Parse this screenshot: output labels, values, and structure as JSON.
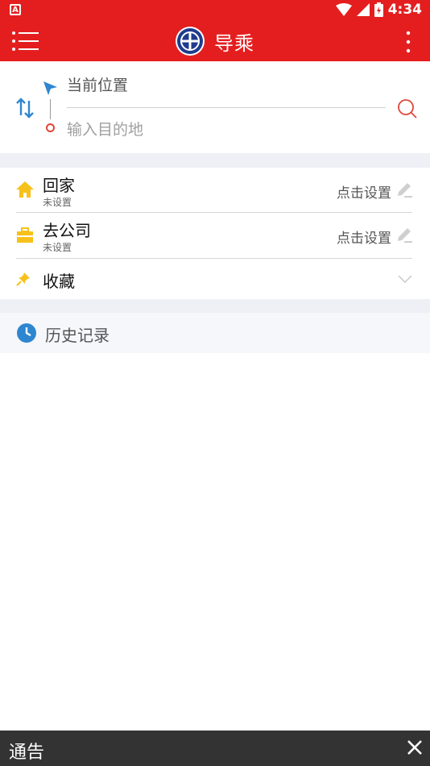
{
  "status_bar": {
    "notification_icon": "A",
    "time": "4:34"
  },
  "app_bar": {
    "title": "导乘"
  },
  "search": {
    "origin": "当前位置",
    "destination_placeholder": "输入目的地"
  },
  "shortcuts": [
    {
      "name": "回家",
      "sub": "未设置",
      "action": "点击设置"
    },
    {
      "name": "去公司",
      "sub": "未设置",
      "action": "点击设置"
    }
  ],
  "favorites": {
    "label": "收藏"
  },
  "history": {
    "label": "历史记录"
  },
  "notice": {
    "label": "通告"
  },
  "colors": {
    "primary_red": "#e41e1f",
    "accent_blue": "#2f86d0",
    "home_yellow": "#f7c11b",
    "notice_bg": "#333333"
  }
}
